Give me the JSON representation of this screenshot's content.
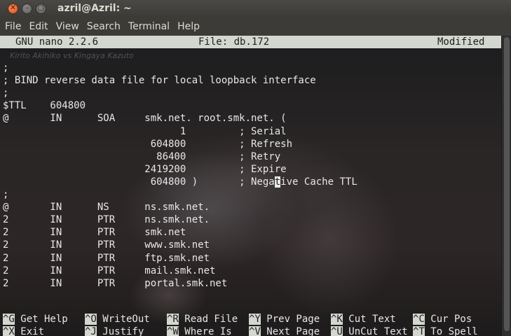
{
  "window": {
    "title": "azril@Azril: ~",
    "close_glyph": "✕",
    "min_glyph": "–",
    "max_glyph": "□"
  },
  "menu": [
    "File",
    "Edit",
    "View",
    "Search",
    "Terminal",
    "Help"
  ],
  "nano": {
    "version": "GNU nano 2.2.6",
    "file": "File: db.172",
    "status": "Modified"
  },
  "watermark": "Kirito Akihiko vs Kingaya Kazuto",
  "lines": [
    ";",
    "; BIND reverse data file for local loopback interface",
    ";",
    "$TTL    604800",
    "@       IN      SOA     smk.net. root.smk.net. (",
    "                              1         ; Serial",
    "                         604800         ; Refresh",
    "                          86400         ; Retry",
    "                        2419200         ; Expire",
    "                         604800 )       ; Negative Cache TTL",
    ";",
    "@       IN      NS      ns.smk.net.",
    "2       IN      PTR     ns.smk.net.",
    "2       IN      PTR     smk.net",
    "2       IN      PTR     www.smk.net",
    "2       IN      PTR     ftp.smk.net",
    "2       IN      PTR     mail.smk.net",
    "2       IN      PTR     portal.smk.net"
  ],
  "cursor_line": 9,
  "cursor_col": 46,
  "shortcuts_row1": [
    {
      "key": "^G",
      "label": "Get Help"
    },
    {
      "key": "^O",
      "label": "WriteOut"
    },
    {
      "key": "^R",
      "label": "Read File"
    },
    {
      "key": "^Y",
      "label": "Prev Page"
    },
    {
      "key": "^K",
      "label": "Cut Text"
    },
    {
      "key": "^C",
      "label": "Cur Pos"
    }
  ],
  "shortcuts_row2": [
    {
      "key": "^X",
      "label": "Exit"
    },
    {
      "key": "^J",
      "label": "Justify"
    },
    {
      "key": "^W",
      "label": "Where Is"
    },
    {
      "key": "^V",
      "label": "Next Page"
    },
    {
      "key": "^U",
      "label": "UnCut Text"
    },
    {
      "key": "^T",
      "label": "To Spell"
    }
  ]
}
